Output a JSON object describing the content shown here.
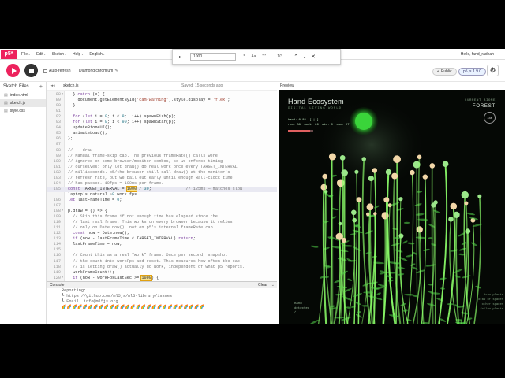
{
  "nav": {
    "logo": "p5*",
    "menu": [
      "File",
      "Edit",
      "Sketch",
      "Help",
      "English"
    ],
    "user": "Hello, fand_radnah"
  },
  "find": {
    "value": "1000",
    "case_label": "Aa",
    "regex_label": ".*",
    "count": "1/3"
  },
  "toolbar": {
    "auto_refresh_label": "Auto-refresh",
    "project_name": "Diamond chromium",
    "public_label": "Public",
    "version_label": "p5.js 1.9.0"
  },
  "sidebar": {
    "title": "Sketch Files",
    "files": [
      {
        "name": "index.html",
        "active": false
      },
      {
        "name": "sketch.js",
        "active": true
      },
      {
        "name": "style.css",
        "active": false
      }
    ]
  },
  "editor": {
    "filename": "sketch.js",
    "saved": "Saved: 15 seconds ago",
    "lines": [
      {
        "n": "88",
        "fold": "▾",
        "t": "  } catch (e) {"
      },
      {
        "n": "89",
        "fold": "",
        "t": "    document.getElementById('cam-warning').style.display = 'flex';"
      },
      {
        "n": "90",
        "fold": "",
        "t": "  }"
      },
      {
        "n": "91",
        "fold": "",
        "t": ""
      },
      {
        "n": "92",
        "fold": "",
        "t": "  for (let i = 0; i < 8;  i++) spawnFish(p);"
      },
      {
        "n": "93",
        "fold": "",
        "t": "  for (let i = 0; i < 90; i++) spawnStar(p);"
      },
      {
        "n": "94",
        "fold": "",
        "t": "  updateBiomeUI();"
      },
      {
        "n": "95",
        "fold": "",
        "t": "  animateLoad();"
      },
      {
        "n": "96",
        "fold": "",
        "t": "};"
      },
      {
        "n": "97",
        "fold": "",
        "t": ""
      },
      {
        "n": "98",
        "fold": "",
        "t": "// ── draw ─────────────────────────────────────────"
      },
      {
        "n": "99",
        "fold": "",
        "t": "// Manual frame-skip cap. The previous frameRate() calls were"
      },
      {
        "n": "100",
        "fold": "",
        "t": "// ignored on some browser/monitor combos, so we enforce timing"
      },
      {
        "n": "101",
        "fold": "",
        "t": "// ourselves: only let draw() do real work once every TARGET_INTERVAL"
      },
      {
        "n": "102",
        "fold": "",
        "t": "// milliseconds. p5/the browser still call draw() at the monitor's"
      },
      {
        "n": "103",
        "fold": "",
        "t": "// refresh rate, but we bail out early until enough wall-clock time"
      },
      {
        "n": "104",
        "fold": "",
        "t": "// has passed. 10fps = 100ms per frame."
      },
      {
        "n": "105",
        "fold": "",
        "t": "const TARGET_INTERVAL = 1000 / 30;              // 125ms — matches slow"
      },
      {
        "n": "",
        "fold": "",
        "t": "laptop's natural ~8 work fps"
      },
      {
        "n": "106",
        "fold": "",
        "t": "let lastFrameTime = 0;"
      },
      {
        "n": "107",
        "fold": "",
        "t": ""
      },
      {
        "n": "108",
        "fold": "▾",
        "t": "p.draw = () => {"
      },
      {
        "n": "109",
        "fold": "",
        "t": "  // Skip this frame if not enough time has elapsed since the"
      },
      {
        "n": "110",
        "fold": "",
        "t": "  // last real frame. This works on every browser because it relies"
      },
      {
        "n": "111",
        "fold": "",
        "t": "  // only on Date.now(), not on p5's internal frameRate cap."
      },
      {
        "n": "112",
        "fold": "",
        "t": "  const now = Date.now();"
      },
      {
        "n": "113",
        "fold": "",
        "t": "  if (now - lastFrameTime < TARGET_INTERVAL) return;"
      },
      {
        "n": "114",
        "fold": "",
        "t": "  lastFrameTime = now;"
      },
      {
        "n": "115",
        "fold": "",
        "t": ""
      },
      {
        "n": "116",
        "fold": "",
        "t": "  // Count this as a real \"work\" frame. Once per second, snapshot"
      },
      {
        "n": "117",
        "fold": "",
        "t": "  // the count into workFps and reset. This measures how often the cap"
      },
      {
        "n": "118",
        "fold": "",
        "t": "  // is letting draw() actually do work, independent of what p5 reports."
      },
      {
        "n": "119",
        "fold": "",
        "t": "  workFrameCount++;"
      },
      {
        "n": "120",
        "fold": "▾",
        "t": "  if (now - workFpsLastSec >= 1000) {"
      },
      {
        "n": "121",
        "fold": "",
        "t": "    workFps = workFrameCount;"
      }
    ]
  },
  "console": {
    "title": "Console",
    "clear_label": "Clear",
    "lines": [
      "Reporting:",
      "┖ https://github.com/ml5js/ml5-library/issues",
      "┖ Email: info@ml5js.org"
    ],
    "emoji_row": "🌈🌈🌈🌈🌈🌈🌈🌈🌈🌈🌈🌈🌈🌈🌈🌈🌈🌈🌈🌈🌈🌈🌈🌈🌈🌈🌈"
  },
  "preview": {
    "label": "Preview",
    "title": "Hand Ecosystem",
    "subtitle": "DIGITAL LIVING WORLD",
    "stats": "hand: 0.88  [|||]\nroo: 88  work: 26  win: 0  osc: 07",
    "biome_label": "CURRENT BIOME",
    "biome": "FOREST",
    "timer": "18s",
    "hand_status": "hand\ndetected\n✓",
    "right_notes": "draw plants\ndraw of spaces\nother spaces\nfollow plants",
    "colors": {
      "glow": "#39e639",
      "stem": "#8cff6a",
      "bud": "#f2d7a8",
      "bg": "#050805"
    }
  }
}
